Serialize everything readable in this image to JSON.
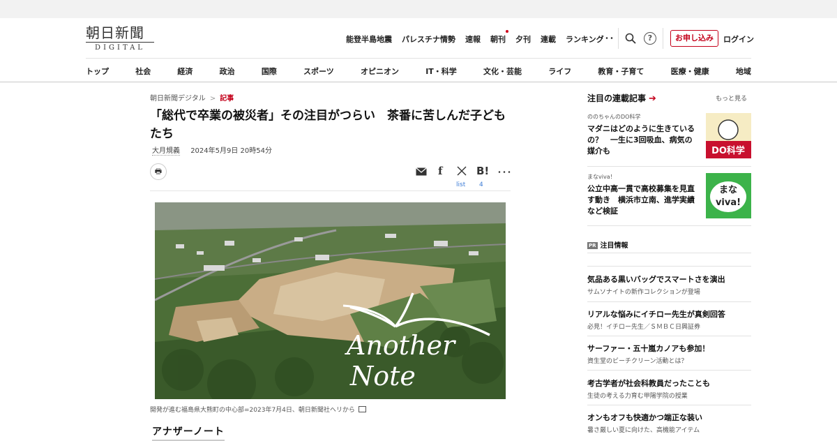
{
  "site": {
    "logo_kanji": "朝日新聞",
    "logo_sub": "DIGITAL"
  },
  "utilnav": [
    "能登半島地震",
    "パレスチナ情勢",
    "速報",
    "朝刊",
    "夕刊",
    "連載",
    "ランキング"
  ],
  "header": {
    "more": "･･･",
    "help": "?",
    "apply": "お申し込み",
    "login": "ログイン"
  },
  "categories": [
    "トップ",
    "社会",
    "経済",
    "政治",
    "国際",
    "スポーツ",
    "オピニオン",
    "IT・科学",
    "文化・芸能",
    "ライフ",
    "教育・子育て",
    "医療・健康",
    "地域"
  ],
  "article": {
    "breadcrumb": [
      "朝日新聞デジタル",
      "記事"
    ],
    "breadcrumb_sep": ">",
    "headline": "「総代で卒業の被災者」その注目がつらい　茶番に苦しんだ子どもたち",
    "author": "大月規義",
    "date": "2024年5月9日 20時54分",
    "share_counts": {
      "list": "list",
      "hatena": "4"
    },
    "share_icons": [
      "print-icon",
      "mail-icon",
      "facebook-icon",
      "x-icon",
      "hatena-bookmark-icon",
      "more-icon"
    ],
    "photo_overlay_line1": "Another",
    "photo_overlay_line2": "Note",
    "caption": "開発が進む福島県大熊町の中心部=2023年7月4日、朝日新聞社ヘリから",
    "section_title": "アナザーノート"
  },
  "sidebar": {
    "heading": "注目の連載記事",
    "more": "もっと見る",
    "cards": [
      {
        "kicker": "ののちゃんのDO科学",
        "title": "マダニはどのように生きているの？　一生に3回吸血、病気の媒介も",
        "thumb_text": "DO科学"
      },
      {
        "kicker": "まなviva！",
        "title": "公立中高一貫で高校募集を見直す動き　横浜市立南、進学実績など検証",
        "thumb_text1": "まな",
        "thumb_text2": "viva!"
      }
    ],
    "pr_tag": "PR",
    "pr_heading": "注目情報",
    "pr_items": [
      {
        "title": "気品ある黒いバッグでスマートさを演出",
        "sub": "サムソナイトの新作コレクションが登場"
      },
      {
        "title": "リアルな悩みにイチロー先生が真剣回答",
        "sub": "必見！イチロー先生／ＳＭＢＣ日興証券"
      },
      {
        "title": "サーファー・五十嵐カノアも参加！",
        "sub": "資生堂のビーチクリーン活動とは？"
      },
      {
        "title": "考古学者が社会科教員だったことも",
        "sub": "生徒の考える力育む甲陽学院の授業"
      },
      {
        "title": "オンもオフも快適かつ端正な装い",
        "sub": "暑さ厳しい夏に向けた、高機能アイテム"
      }
    ]
  },
  "colors": {
    "accent": "#c4001a",
    "link": "#3b7bd6"
  }
}
